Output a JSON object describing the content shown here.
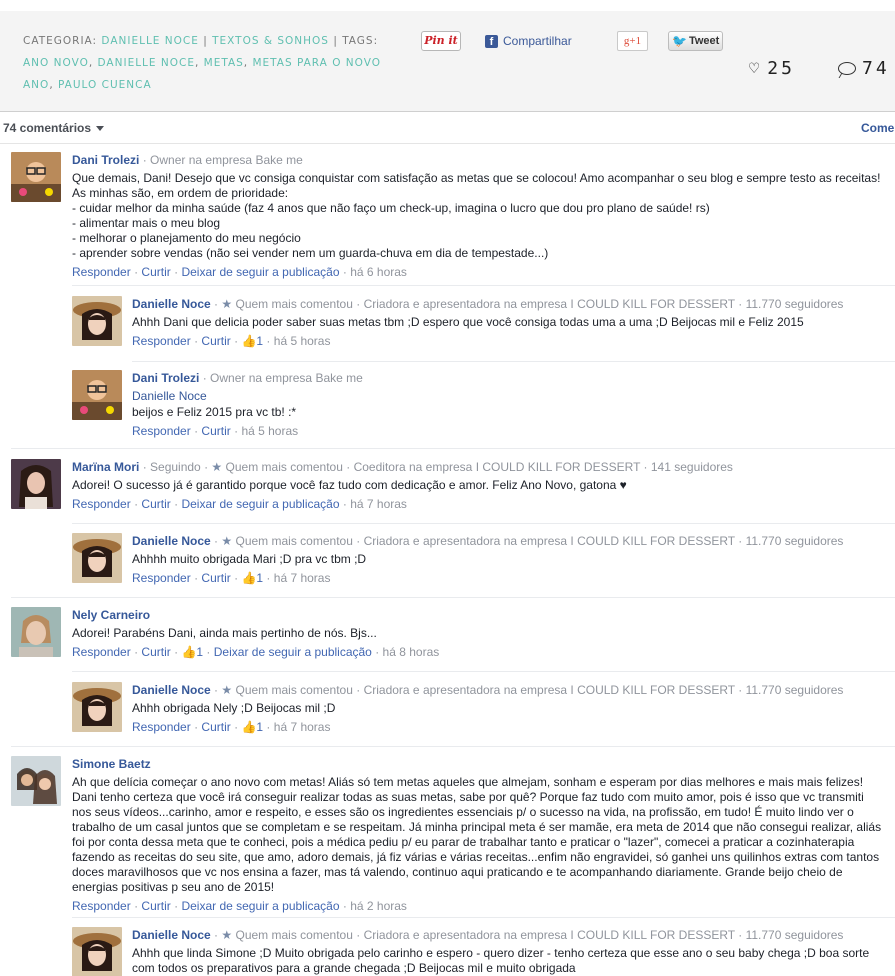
{
  "post_meta": {
    "category_label": "CATEGORIA:",
    "category_links": [
      "DANIELLE NOCE",
      "TEXTOS & SONHOS"
    ],
    "tags_label": "TAGS:",
    "tags": [
      "ANO NOVO",
      "DANIELLE NOCE",
      "METAS",
      "METAS PARA O NOVO ANO",
      "PAULO CUENCA"
    ]
  },
  "share": {
    "pinit": "Pin it",
    "facebook": "Compartilhar",
    "gplus": "g+1",
    "tweet": "Tweet",
    "likes": "25",
    "comments": "74"
  },
  "comments_bar": {
    "count_label": "74 comentários",
    "sort_label": "Comentar"
  },
  "actions": {
    "reply": "Responder",
    "like": "Curtir",
    "unfollow": "Deixar de seguir a publicação"
  },
  "comments": [
    {
      "author": "Dani Trolezi",
      "role": "· Owner na empresa",
      "company": "Bake me",
      "text": "Que demais, Dani! Desejo que vc consiga conquistar com satisfação as metas que se colocou! Amo acompanhar o seu blog e sempre testo as receitas!\nAs minhas são, em ordem de prioridade:\n- cuidar melhor da minha saúde (faz 4 anos que não faço um check-up, imagina o lucro que dou pro plano de saúde! rs)\n- alimentar mais o meu blog\n- melhorar o planejamento do meu negócio\n- aprender sobre vendas (não sei vender nem um guarda-chuva em dia de tempestade...)",
      "time": "há 6 horas"
    },
    {
      "author": "Danielle Noce",
      "badge": "Quem mais comentou",
      "role": "Criadora e apresentadora",
      "company_prefix": "na empresa",
      "company": "I COULD KILL FOR DESSERT",
      "followers": "· 11.770 seguidores",
      "text": "Ahhh Dani que delicia poder saber suas metas tbm ;D espero que você consiga todas uma a uma ;D Beijocas mil e Feliz 2015",
      "likes": "1",
      "time": "há 5 horas"
    },
    {
      "author": "Dani Trolezi",
      "role": "· Owner na empresa",
      "company": "Bake me",
      "mention": "Danielle Noce",
      "text": "beijos e Feliz 2015 pra vc tb! :*",
      "time": "há 5 horas"
    },
    {
      "author": "Marïna Mori",
      "status": "· Seguindo ·",
      "badge": "Quem mais comentou",
      "role": "Coeditora",
      "company_prefix": "na empresa",
      "company": "I COULD KILL FOR DESSERT",
      "followers": "· 141 seguidores",
      "text": "Adorei! O sucesso já é garantido porque você faz tudo com dedicação e amor. Feliz Ano Novo, gatona ♥",
      "time": "há 7 horas"
    },
    {
      "author": "Danielle Noce",
      "badge": "Quem mais comentou",
      "role": "Criadora e apresentadora",
      "company_prefix": "na empresa",
      "company": "I COULD KILL FOR DESSERT",
      "followers": "· 11.770 seguidores",
      "text": "Ahhhh muito obrigada Mari ;D pra vc tbm ;D",
      "likes": "1",
      "time": "há 7 horas"
    },
    {
      "author": "Nely Carneiro",
      "text": "Adorei! Parabéns Dani, ainda mais pertinho de nós. Bjs...",
      "likes": "1",
      "time": "há 8 horas"
    },
    {
      "author": "Danielle Noce",
      "badge": "Quem mais comentou",
      "role": "Criadora e apresentadora",
      "company_prefix": "na empresa",
      "company": "I COULD KILL FOR DESSERT",
      "followers": "· 11.770 seguidores",
      "text": "Ahhh obrigada Nely ;D Beijocas mil ;D",
      "likes": "1",
      "time": "há 7 horas"
    },
    {
      "author": "Simone Baetz",
      "text": "Ah que delícia começar o ano novo com metas! Aliás só tem metas aqueles que almejam, sonham e esperam por dias melhores e mais mais felizes!\nDani tenho certeza que você irá conseguir realizar todas as suas metas, sabe por quê? Porque faz tudo com muito amor, pois é isso que vc transmiti\nnos seus vídeos...carinho, amor e respeito, e esses são os ingredientes essenciais p/ o sucesso na vida, na profissão, em tudo! É muito lindo ver o\ntrabalho de um casal juntos que se completam e se respeitam. Já minha principal meta é ser mamãe, era meta de 2014 que não consegui realizar, aliás\nfoi por conta dessa meta que te conheci, pois a médica pediu p/ eu parar de trabalhar tanto e praticar o \"lazer\", comecei a praticar a cozinhaterapia\nfazendo as receitas do seu site, que amo, adoro demais, já fiz várias e várias receitas...enfim não engravidei, só ganhei uns quilinhos extras com tantos\ndoces maravilhosos que vc nos ensina a fazer, mas tá valendo, continuo aqui praticando e te acompanhando diariamente. Grande beijo cheio de\nenergias positivas p seu ano de 2015!",
      "time": "há 2 horas"
    },
    {
      "author": "Danielle Noce",
      "badge": "Quem mais comentou",
      "role": "Criadora e apresentadora",
      "company_prefix": "na empresa",
      "company": "I COULD KILL FOR DESSERT",
      "followers": "· 11.770 seguidores",
      "text": "Ahhh que linda Simone ;D Muito obrigada pelo carinho e espero - quero dizer - tenho certeza que esse ano o seu baby chega ;D boa sorte\ncom todos os preparativos para a grande chegada ;D Beijocas mil e muito obrigada"
    }
  ],
  "colors": {
    "accent_teal": "#5fbfb0",
    "link_blue": "#365899",
    "muted": "#90949c"
  }
}
